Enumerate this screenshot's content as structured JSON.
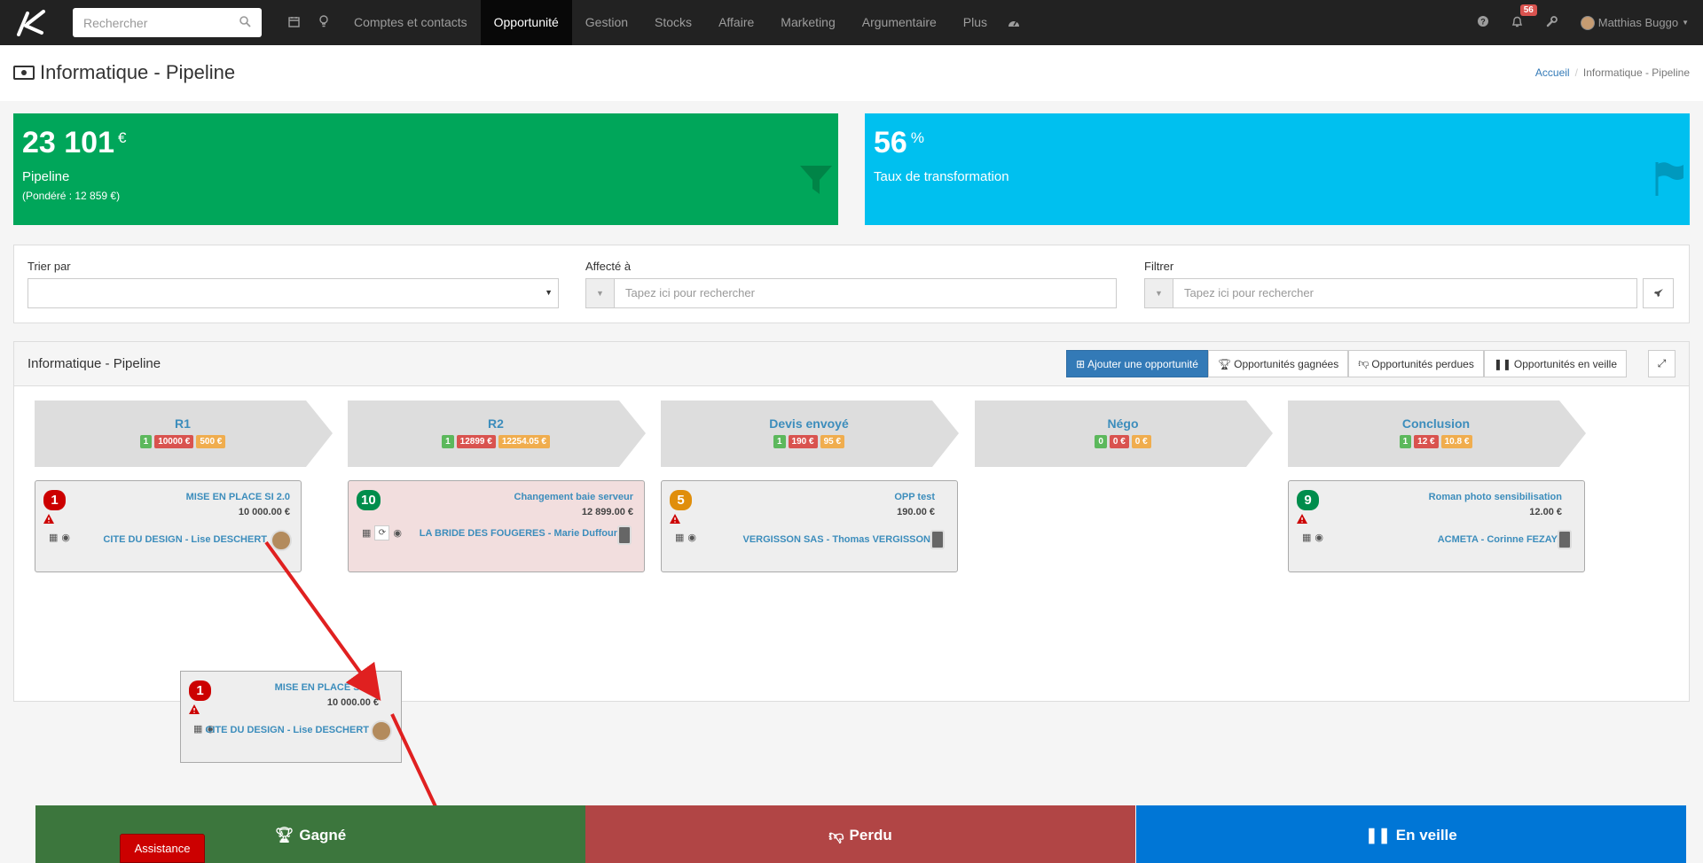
{
  "navbar": {
    "search_placeholder": "Rechercher",
    "items": [
      {
        "label": "Comptes et contacts"
      },
      {
        "label": "Opportunité"
      },
      {
        "label": "Gestion"
      },
      {
        "label": "Stocks"
      },
      {
        "label": "Affaire"
      },
      {
        "label": "Marketing"
      },
      {
        "label": "Argumentaire"
      },
      {
        "label": "Plus"
      }
    ],
    "notification_count": "56",
    "user_name": "Matthias Buggo"
  },
  "header": {
    "title": "Informatique - Pipeline",
    "breadcrumb": {
      "home": "Accueil",
      "current": "Informatique - Pipeline"
    }
  },
  "kpi": {
    "pipeline_value": "23 101",
    "pipeline_unit": "€",
    "pipeline_label": "Pipeline",
    "pipeline_weighted": "(Pondéré : 12 859 €)",
    "rate_value": "56",
    "rate_unit": "%",
    "rate_label": "Taux de transformation"
  },
  "filters": {
    "sort_label": "Trier par",
    "assigned_label": "Affecté à",
    "assigned_placeholder": "Tapez ici pour rechercher",
    "filter_label": "Filtrer",
    "filter_placeholder": "Tapez ici pour rechercher"
  },
  "pipeline": {
    "title": "Informatique - Pipeline",
    "buttons": {
      "add": "Ajouter une opportunité",
      "won": "Opportunités gagnées",
      "lost": "Opportunités perdues",
      "watch": "Opportunités en veille"
    },
    "stages": [
      {
        "name": "R1",
        "count": "1",
        "amount": "10000 €",
        "weighted": "500 €"
      },
      {
        "name": "R2",
        "count": "1",
        "amount": "12899 €",
        "weighted": "12254.05 €"
      },
      {
        "name": "Devis envoyé",
        "count": "1",
        "amount": "190 €",
        "weighted": "95 €"
      },
      {
        "name": "Négo",
        "count": "0",
        "amount": "0 €",
        "weighted": "0 €"
      },
      {
        "name": "Conclusion",
        "count": "1",
        "amount": "12 €",
        "weighted": "10.8 €"
      }
    ],
    "cards": [
      {
        "num": "1",
        "title": "MISE EN PLACE SI 2.0",
        "amount": "10 000.00 €",
        "contact": "CITE DU DESIGN - Lise DESCHERT"
      },
      {
        "num": "10",
        "title": "Changement baie serveur",
        "amount": "12 899.00 €",
        "contact": "LA BRIDE DES FOUGERES - Marie Duffour"
      },
      {
        "num": "5",
        "title": "OPP test",
        "amount": "190.00 €",
        "contact": "VERGISSON SAS - Thomas VERGISSON"
      },
      {
        "num": "9",
        "title": "Roman photo sensibilisation",
        "amount": "12.00 €",
        "contact": "ACMETA - Corinne FEZAY"
      }
    ],
    "dragged": {
      "num": "1",
      "title": "MISE EN PLACE SI 2.0",
      "amount": "10 000.00 €",
      "contact": "CITE DU DESIGN - Lise DESCHERT"
    }
  },
  "dropzones": {
    "won": "Gagné",
    "lost": "Perdu",
    "watch": "En veille"
  },
  "assistance": "Assistance",
  "colors": {
    "navbar": "#222222",
    "pipeline_green": "#00a65a",
    "rate_blue": "#00c0ef",
    "won": "#3c763d",
    "lost": "#b14545",
    "watch": "#0076d6",
    "arrow": "#e02020"
  }
}
